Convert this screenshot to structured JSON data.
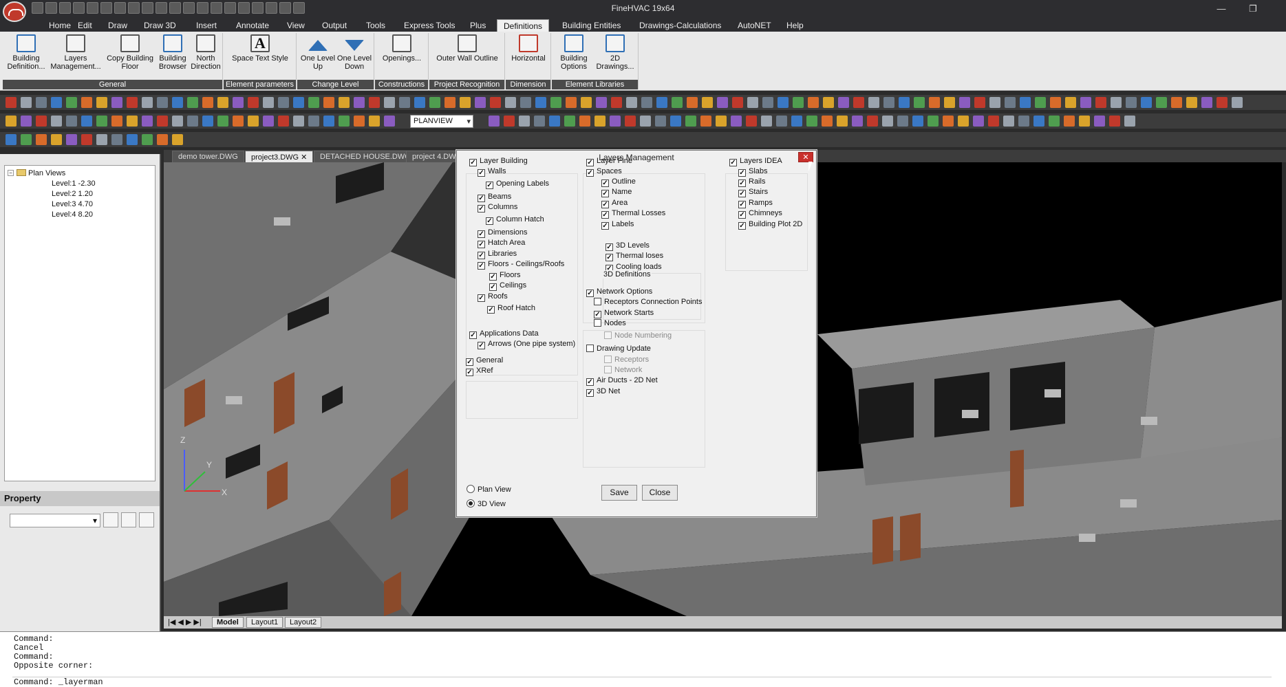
{
  "app": {
    "title": "FineHVAC 19x64"
  },
  "menu": [
    "Home",
    "Edit",
    "Draw",
    "Draw 3D",
    "Insert",
    "Annotate",
    "View",
    "Output",
    "Tools",
    "Express Tools",
    "Plus",
    "Definitions",
    "Building Entities",
    "Drawings-Calculations",
    "AutoNET",
    "Help"
  ],
  "ribbon": {
    "groups": [
      {
        "label": "General",
        "buttons": [
          "Building Definition...",
          "Layers Management...",
          "Copy Building Floor",
          "Building Browser",
          "North Direction"
        ]
      },
      {
        "label": "Element parameters",
        "buttons": [
          "Space Text Style"
        ]
      },
      {
        "label": "Change Level",
        "buttons": [
          "One Level Up",
          "One Level Down"
        ]
      },
      {
        "label": "Constructions",
        "buttons": [
          "Openings..."
        ]
      },
      {
        "label": "Project Recognition",
        "buttons": [
          "Outer Wall Outline"
        ]
      },
      {
        "label": "Dimension",
        "buttons": [
          "Horizontal"
        ]
      },
      {
        "label": "Element Libraries",
        "buttons": [
          "Building Options",
          "2D Drawings..."
        ]
      }
    ]
  },
  "toolbar": {
    "view_select": "PLANVIEW"
  },
  "tree": {
    "root": "Plan Views",
    "levels": [
      "Level:1  -2.30",
      "Level:2  1.20",
      "Level:3  4.70",
      "Level:4  8.20"
    ]
  },
  "property": {
    "header": "Property"
  },
  "tabs": [
    "demo tower.DWG",
    "project3.DWG",
    "DETACHED HOUSE.DWG",
    "project 4.DW"
  ],
  "layouts": [
    "Model",
    "Layout1",
    "Layout2"
  ],
  "command": {
    "lines": [
      "Command:",
      "Cancel",
      "Command:",
      "Opposite corner:"
    ],
    "input": "Command:  _layerman"
  },
  "dialog": {
    "title": "Layers Management",
    "col1": [
      "Layer Building",
      "Walls",
      "Opening Labels",
      "Beams",
      "Columns",
      "Column Hatch",
      "Dimensions",
      "Hatch Area",
      "Libraries",
      "Floors - Ceilings/Roofs",
      "Floors",
      "Ceilings",
      "Roofs",
      "Roof Hatch"
    ],
    "col1b": [
      "Applications Data",
      "Arrows (One pipe system)"
    ],
    "col1c": [
      "General",
      "XRef"
    ],
    "col2": [
      "Layer Fine",
      "Spaces",
      "Outline",
      "Name",
      "Area",
      "Thermal Losses",
      "Labels"
    ],
    "defs_label": "3D Definitions",
    "defs": [
      "3D Levels",
      "Thermal loses",
      "Cooling loads"
    ],
    "network": [
      "Network Options",
      "Receptors Connection Points",
      "Network Starts",
      "Nodes",
      "Node Numbering"
    ],
    "drawing": [
      "Drawing Update",
      "Receptors",
      "Network",
      "Air Ducts - 2D Net",
      "3D Net"
    ],
    "col3": [
      "Layers IDEA",
      "Slabs",
      "Rails",
      "Stairs",
      "Ramps",
      "Chimneys",
      "Building Plot 2D"
    ],
    "views": [
      "Plan View",
      "3D View"
    ],
    "save": "Save",
    "close": "Close",
    "close_x": "✕"
  }
}
